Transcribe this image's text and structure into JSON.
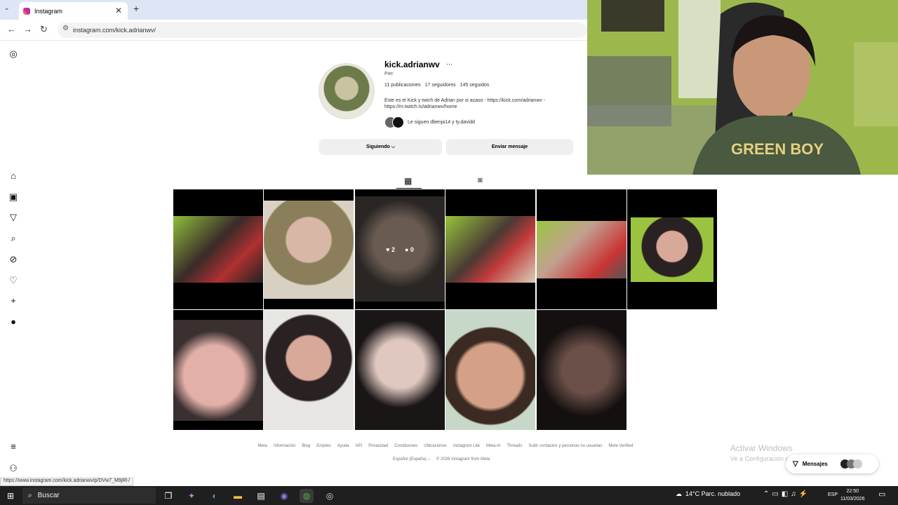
{
  "browser": {
    "tab_title": "Instagram",
    "tab_close": "✕",
    "new_tab": "+",
    "url": "instagram.com/kick.adrianwv/",
    "status_url": "https://www.instagram.com/kick.adrianwv/p/DVw7_M9jRl-/"
  },
  "profile": {
    "username": "kick.adrianwv",
    "more": "···",
    "full_name": "Pier",
    "posts": "11 publicaciones",
    "followers": "17 seguidores",
    "following": "145 seguidos",
    "bio_line1": "Este es el Kick y twich de Adrian por si acaso - https://kick.com/adrianwv -",
    "bio_line2": "https://m.twitch.tv/adrianwv/home",
    "followed_by": "Le siguen dbenja14 y ty.davidd",
    "follow_button": "Siguiendo ⌵",
    "message_button": "Enviar mensaje"
  },
  "tabs": {
    "grid_icon": "grid-icon",
    "tagged_icon": "tagged-icon"
  },
  "hover_post": {
    "likes": "2",
    "comments": "0"
  },
  "footer": {
    "links": [
      "Meta",
      "Información",
      "Blog",
      "Empleo",
      "Ayuda",
      "API",
      "Privacidad",
      "Condiciones",
      "Ubicaciones",
      "Instagram Lite",
      "Meta AI",
      "Threads",
      "Subir contactos y personas no usuarias",
      "Meta Verified"
    ],
    "language": "Español (España) ⌵",
    "copyright": "© 2026 Instagram from Meta"
  },
  "watermark": {
    "title": "Activar Windows",
    "subtitle": "Ve a Configuración para activar Windows."
  },
  "messages_label": "Mensajes",
  "taskbar": {
    "search": "Buscar",
    "weather": "14°C  Parc. nublado",
    "lang": "ESP",
    "time": "22:50",
    "date": "11/03/2026"
  },
  "colors": {
    "tab_bar": "#dde6f5",
    "button_bg": "#efefef",
    "taskbar": "#1f1f1f"
  }
}
